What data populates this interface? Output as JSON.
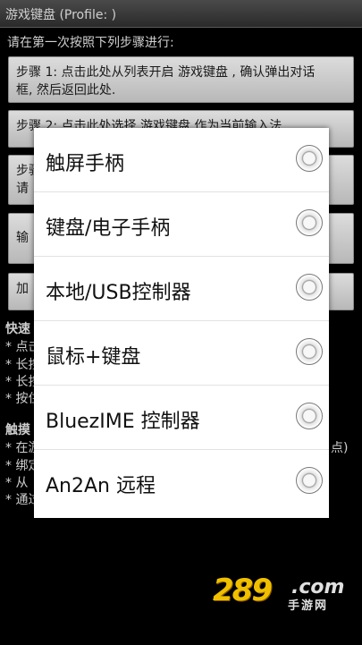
{
  "titlebar": {
    "title": "游戏键盘 (Profile: )"
  },
  "instruction": "请在第一次按照下列步骤进行:",
  "steps": [
    {
      "line1": "步骤 1: 点击此处从列表开启 游戏键盘 , 确认弹出对话",
      "line2": "框, 然后返回此处."
    },
    {
      "line1": "步骤 2: 点击此处选择 游戏键盘 作为当前输入法",
      "line2": ""
    },
    {
      "line1": "步骤",
      "line2": "请"
    },
    {
      "line1": "输",
      "line2": ""
    },
    {
      "line1": "加",
      "line2": ""
    }
  ],
  "sections": {
    "quick": {
      "label": "快速",
      "bullets": [
        "* 点击",
        "* 长按",
        "* 长按",
        "* 按住"
      ]
    },
    "touch": {
      "label": "触摸",
      "bullets": [
        "* 在游",
        "* 绑定",
        "* 从",
        "* 通过"
      ],
      "right_text": "点)"
    }
  },
  "dialog": {
    "options": [
      {
        "label": "触屏手柄"
      },
      {
        "label": "键盘/电子手柄"
      },
      {
        "label": "本地/USB控制器"
      },
      {
        "label": "鼠标+键盘"
      },
      {
        "label": "BluezIME 控制器"
      },
      {
        "label": "An2An 远程"
      }
    ]
  },
  "watermark": {
    "main": "289",
    "domain": ".com",
    "sub": "手游网"
  }
}
